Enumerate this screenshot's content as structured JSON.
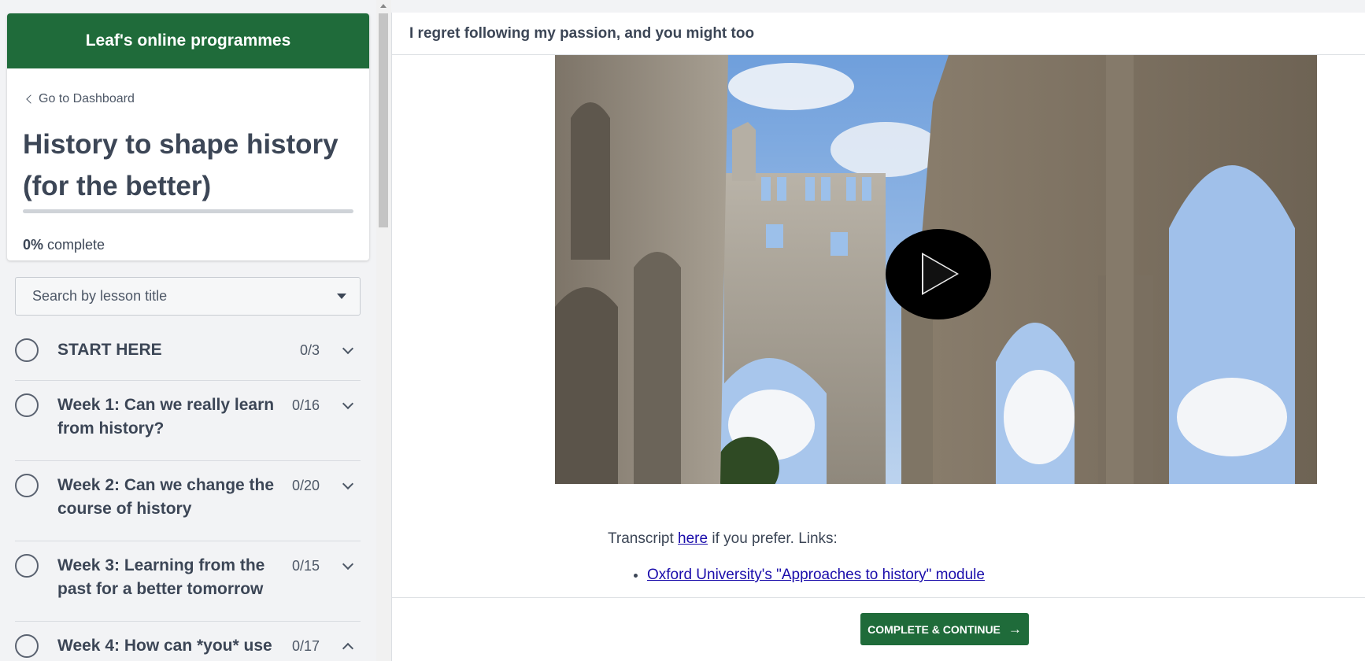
{
  "sidebar": {
    "brand": "Leaf's online programmes",
    "dashboard_link": "Go to Dashboard",
    "course_title": "History to shape history (for the better)",
    "progress": {
      "percent": "0%",
      "percent_value": 0,
      "suffix": "complete"
    },
    "search_placeholder": "Search by lesson title",
    "sections": [
      {
        "title": "START HERE",
        "count": "0/3",
        "expanded": false
      },
      {
        "title": "Week 1: Can we really learn from history?",
        "count": "0/16",
        "expanded": false
      },
      {
        "title": "Week 2: Can we change the course of history",
        "count": "0/20",
        "expanded": false
      },
      {
        "title": "Week 3: Learning from the past for a better tomorrow",
        "count": "0/15",
        "expanded": false
      },
      {
        "title": "Week 4: How can *you* use",
        "count": "0/17",
        "expanded": true
      }
    ]
  },
  "main": {
    "lesson_title": "I regret following my passion, and you might too",
    "transcript": {
      "prefix": "Transcript",
      "link": "here",
      "suffix": "if you prefer. Links:"
    },
    "links": [
      "Oxford University's \"Approaches to history\" module"
    ],
    "complete_button": "COMPLETE & CONTINUE"
  },
  "colors": {
    "brand_green": "#1f6b3a",
    "link_blue": "#1a0dab",
    "sidebar_bg": "#f2f3f5"
  },
  "icons": [
    "chevron-left-icon",
    "caret-down-icon",
    "chevron-down-icon",
    "chevron-up-icon",
    "play-icon",
    "arrow-right-icon"
  ]
}
